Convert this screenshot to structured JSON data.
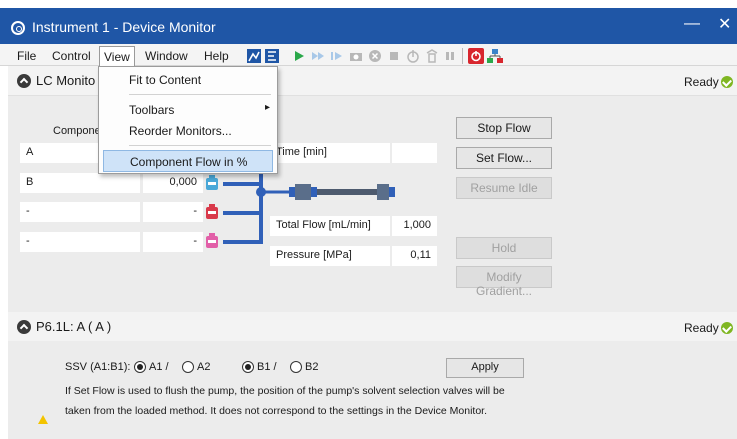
{
  "window": {
    "title": "Instrument 1 - Device Monitor",
    "minimize": "—",
    "close": "✕"
  },
  "menubar": {
    "items": [
      "File",
      "Control",
      "View",
      "Window",
      "Help"
    ]
  },
  "toolbar": {
    "icons": [
      "chart-icon",
      "flow-icon",
      "play-icon",
      "fast-forward-icon",
      "step-icon",
      "camera-icon",
      "stop-circle-icon",
      "square-icon",
      "valve-icon",
      "lamp-icon",
      "pause-icon",
      "power-icon",
      "network-icon"
    ]
  },
  "view_menu": {
    "items": [
      {
        "label": "Fit to Content"
      },
      {
        "label": "Toolbars",
        "submenu": "▸"
      },
      {
        "label": "Reorder Monitors..."
      },
      {
        "label": "Component Flow in %"
      }
    ]
  },
  "lc_section": {
    "title": "LC Monito",
    "status": "Ready",
    "column_header": "Compone",
    "rows": [
      {
        "component": "A",
        "value": ""
      },
      {
        "component": "B",
        "value": "0,000"
      },
      {
        "component": "-",
        "value": "-"
      },
      {
        "component": "-",
        "value": "-"
      }
    ],
    "time_label": "Time [min]",
    "total_flow_label": "Total Flow [mL/min]",
    "total_flow_value": "1,000",
    "pressure_label": "Pressure [MPa]",
    "pressure_value": "0,11",
    "buttons": {
      "stop_flow": "Stop Flow",
      "set_flow": "Set Flow...",
      "resume_idle": "Resume Idle",
      "hold": "Hold",
      "modify_gradient": "Modify Gradient..."
    },
    "bottle_colors": [
      "#4aa8d8",
      "#4aa8d8",
      "#d9394a",
      "#e25fa8"
    ]
  },
  "p6_section": {
    "title": "P6.1L: A ( A )",
    "status": "Ready",
    "ssv_label": "SSV (A1:B1):",
    "radio_a": "A1 / ",
    "radio_a2": "A2",
    "radio_b": "B1 / ",
    "radio_b2": "B2",
    "apply": "Apply",
    "note_line1": "If Set Flow is used to flush the pump, the position of the pump's solvent selection valves will be",
    "note_line2": "taken from the loaded method. It does not correspond to the settings in the Device Monitor."
  }
}
